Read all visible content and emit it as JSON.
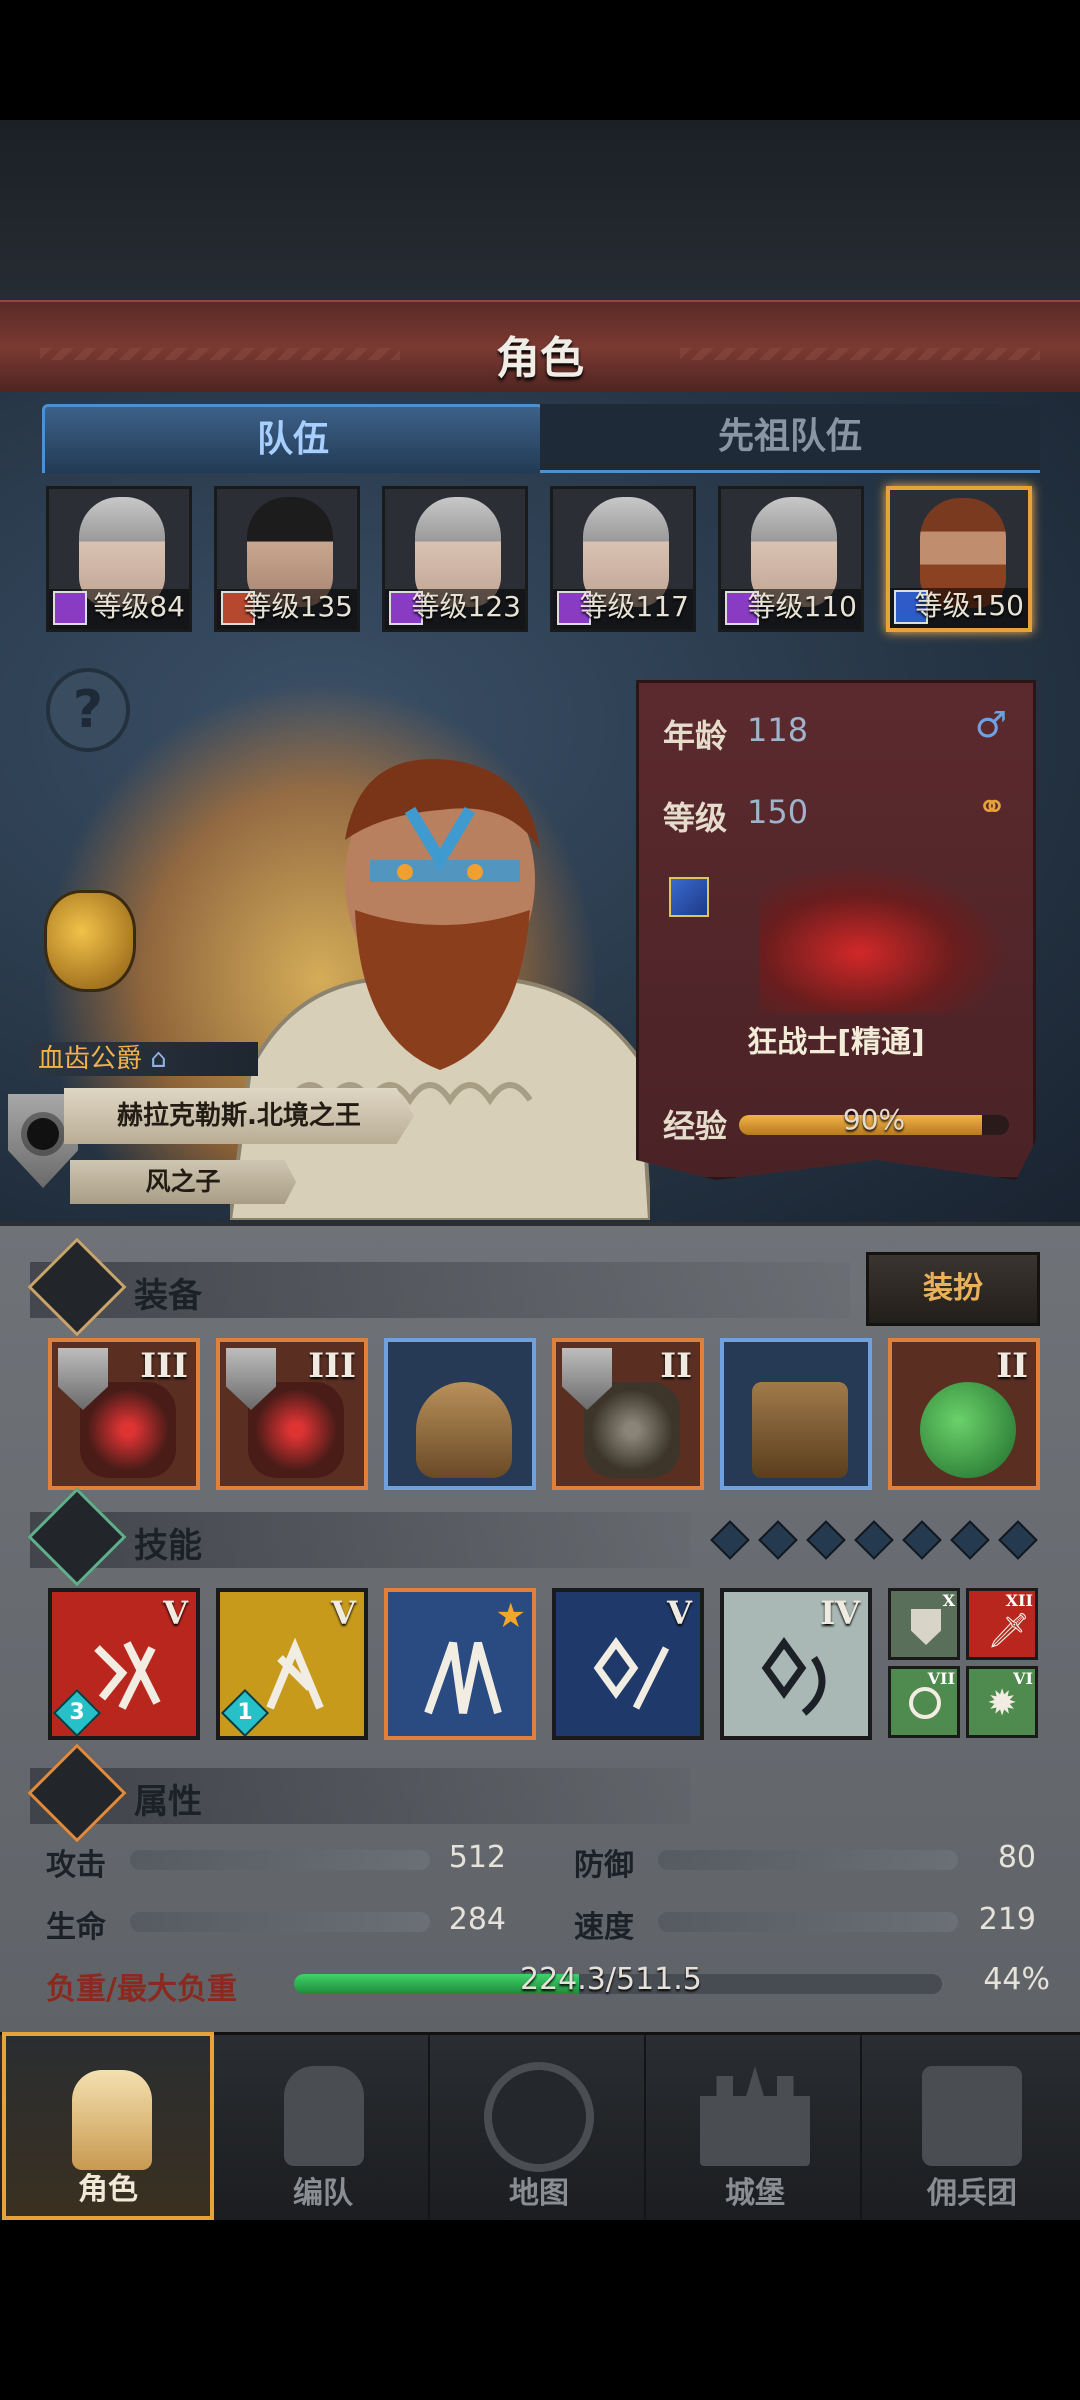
{
  "header": {
    "title": "角色"
  },
  "tabs": [
    {
      "label": "队伍",
      "active": true
    },
    {
      "label": "先祖队伍",
      "active": false
    }
  ],
  "party": [
    {
      "level_text": "等级84",
      "class_color": "#8a3bc4",
      "face": "silver"
    },
    {
      "level_text": "等级135",
      "class_color": "#b5482f",
      "face": "dark"
    },
    {
      "level_text": "等级123",
      "class_color": "#8a3bc4",
      "face": "silver"
    },
    {
      "level_text": "等级117",
      "class_color": "#8a3bc4",
      "face": "silver"
    },
    {
      "level_text": "等级110",
      "class_color": "#8a3bc4",
      "face": "silver"
    },
    {
      "level_text": "等级150",
      "class_color": "#2f5bc8",
      "face": "beard",
      "selected": true
    }
  ],
  "character": {
    "title_tag": "血齿公爵",
    "name": "赫拉克勒斯.北境之王",
    "subtitle": "风之子",
    "age_label": "年龄",
    "age": "118",
    "gender_icon": "♂",
    "level_label": "等级",
    "level": "150",
    "ring_icon": "ring-icon",
    "class_name": "狂战士[精通]",
    "xp_label": "经验",
    "xp_text": "90%",
    "xp_progress": 0.9
  },
  "equipment": {
    "title": "装备",
    "dress_button": "装扮",
    "slots": [
      {
        "tier": "III",
        "rarity": "orange",
        "shield": true,
        "item": "axe"
      },
      {
        "tier": "III",
        "rarity": "orange",
        "shield": true,
        "item": "axe"
      },
      {
        "tier": "",
        "rarity": "blue",
        "shield": false,
        "item": "helmet"
      },
      {
        "tier": "II",
        "rarity": "orange",
        "shield": true,
        "item": "armor"
      },
      {
        "tier": "",
        "rarity": "blue",
        "shield": false,
        "item": "boots"
      },
      {
        "tier": "II",
        "rarity": "orange",
        "shield": false,
        "item": "trinket"
      }
    ]
  },
  "skills": {
    "title": "技能",
    "points": 7,
    "main": [
      {
        "tier": "V",
        "bg": "#b8261e",
        "count": "3"
      },
      {
        "tier": "V",
        "bg": "#c89a1c",
        "count": "1"
      },
      {
        "tier": "",
        "bg": "#2a4a82",
        "star": true
      },
      {
        "tier": "V",
        "bg": "#1f3a6a"
      },
      {
        "tier": "IV",
        "bg": "#a9b8b4"
      }
    ],
    "passive": [
      {
        "tier": "X",
        "bg": "#5a6f5a"
      },
      {
        "tier": "XII",
        "bg": "#b8261e"
      },
      {
        "tier": "VII",
        "bg": "#4f8a4f"
      },
      {
        "tier": "VI",
        "bg": "#4f8a4f"
      }
    ]
  },
  "attributes": {
    "title": "属性",
    "stats": [
      {
        "label": "攻击",
        "value": "512"
      },
      {
        "label": "防御",
        "value": "80"
      },
      {
        "label": "生命",
        "value": "284"
      },
      {
        "label": "速度",
        "value": "219"
      }
    ],
    "load_label": "负重/最大负重",
    "load_text": "224.3/511.5",
    "load_pct": "44%",
    "load_fraction": 0.44
  },
  "nav": [
    {
      "label": "角色",
      "active": true
    },
    {
      "label": "编队",
      "active": false
    },
    {
      "label": "地图",
      "active": false
    },
    {
      "label": "城堡",
      "active": false
    },
    {
      "label": "佣兵团",
      "active": false
    }
  ],
  "colors": {
    "accent": "#e8a23a",
    "tab_blue": "#4f8fd0",
    "panel_red": "#5b2a2e"
  }
}
